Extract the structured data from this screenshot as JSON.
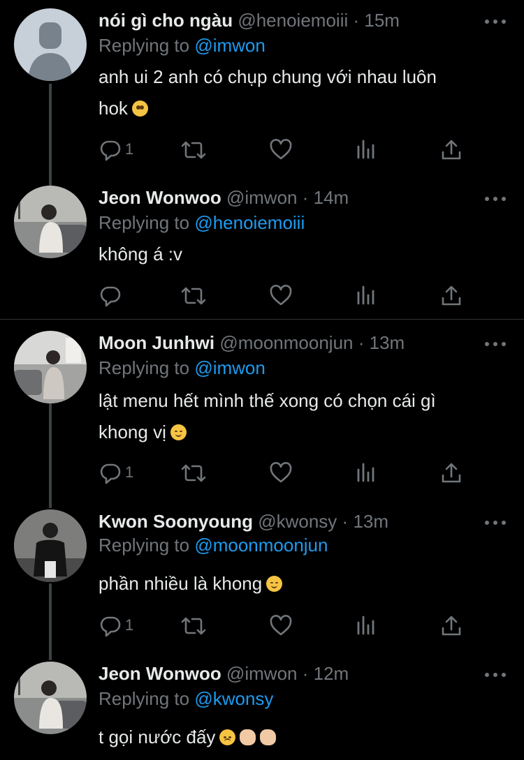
{
  "tweets": [
    {
      "name": "nói gì cho ngàu",
      "handle": "@henoiemoiii",
      "time": "15m",
      "replying_label": "Replying to",
      "replying_to": "@imwon",
      "text_lines": [
        "anh ui 2 anh có chụp chung với nhau luôn",
        "hok"
      ],
      "reply_count": "1",
      "avatar": "default-avatar"
    },
    {
      "name": "Jeon Wonwoo",
      "handle": "@imwon",
      "time": "14m",
      "replying_label": "Replying to",
      "replying_to": "@henoiemoiii",
      "text_lines": [
        "không á :v"
      ],
      "reply_count": "",
      "avatar": "photo-avatar"
    },
    {
      "name": "Moon Junhwi",
      "handle": "@moonmoonjun",
      "time": "13m",
      "replying_label": "Replying to",
      "replying_to": "@imwon",
      "text_lines": [
        "lật menu hết mình thế xong có chọn cái gì",
        "khong vị"
      ],
      "reply_count": "1",
      "avatar": "photo-avatar"
    },
    {
      "name": "Kwon Soonyoung",
      "handle": "@kwonsy",
      "time": "13m",
      "replying_label": "Replying to",
      "replying_to": "@moonmoonjun",
      "text_lines": [
        "phần nhiều là khong"
      ],
      "reply_count": "1",
      "avatar": "photo-avatar"
    },
    {
      "name": "Jeon Wonwoo",
      "handle": "@imwon",
      "time": "12m",
      "replying_label": "Replying to",
      "replying_to": "@kwonsy",
      "text_lines": [
        "t gọi nước đấy"
      ],
      "reply_count": "",
      "avatar": "photo-avatar"
    }
  ],
  "icons": [
    "reply-icon",
    "retweet-icon",
    "like-icon",
    "analytics-icon",
    "share-icon",
    "more-icon"
  ],
  "colors": {
    "background": "#000000",
    "text": "#e7e9ea",
    "muted": "#71767b",
    "link": "#1d9bf0",
    "thread_line": "#3d4144"
  }
}
